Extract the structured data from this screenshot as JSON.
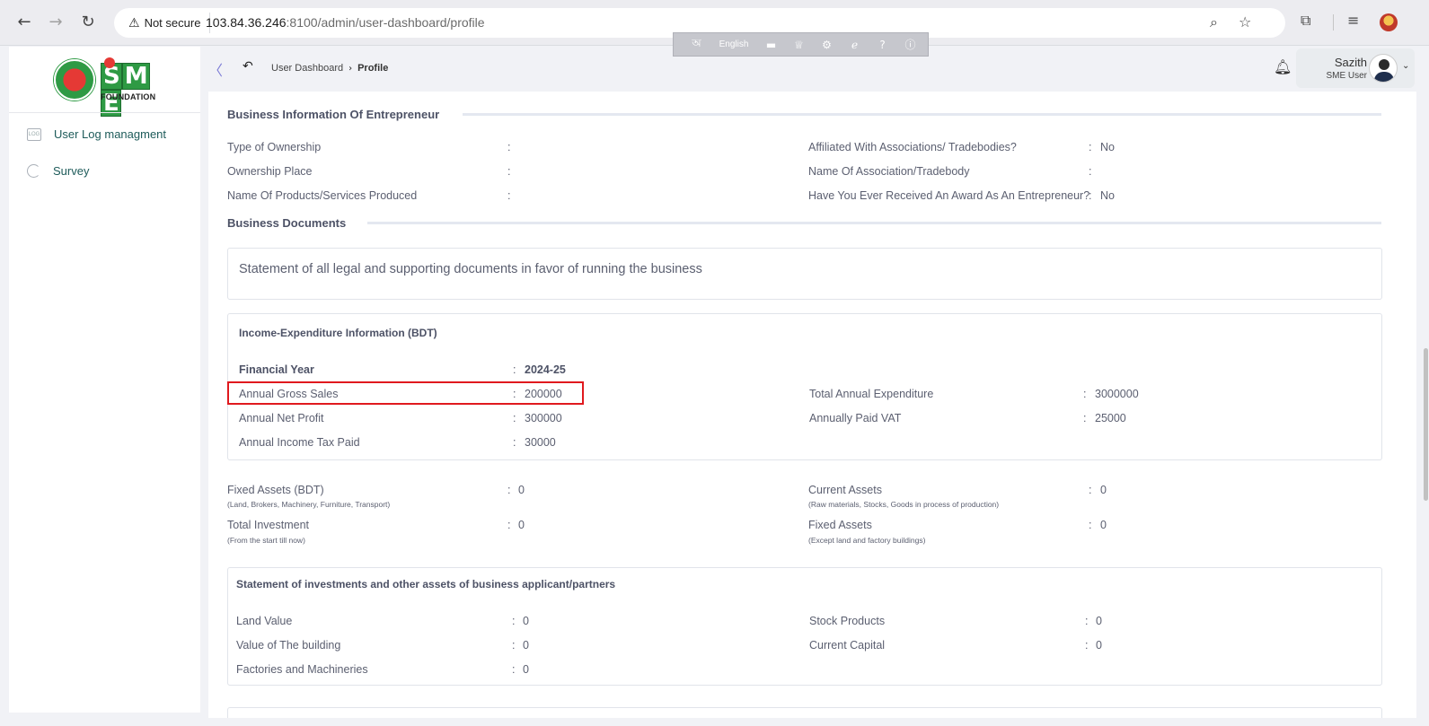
{
  "browser": {
    "security_label": "Not secure",
    "url_host": "103.84.36.246",
    "url_rest": ":8100/admin/user-dashboard/profile",
    "language_bar": {
      "language": "English"
    }
  },
  "sidebar": {
    "items": [
      {
        "label": "User Log managment",
        "icon": "log-icon"
      },
      {
        "label": "Survey",
        "icon": "pie-chart-icon"
      }
    ],
    "logo": {
      "text_s": "S",
      "text_m": "M",
      "text_e": "E",
      "foundation": "FOUNDATION"
    }
  },
  "header": {
    "breadcrumb": {
      "parent": "User Dashboard",
      "current": "Profile"
    },
    "user": {
      "name": "Sazith",
      "role": "SME User"
    }
  },
  "business_info": {
    "title": "Business Information Of Entrepreneur",
    "left": [
      {
        "label": "Type of Ownership",
        "value": ""
      },
      {
        "label": "Ownership Place",
        "value": ""
      },
      {
        "label": "Name Of Products/Services Produced",
        "value": ""
      }
    ],
    "right": [
      {
        "label": "Affiliated With Associations/ Tradebodies?",
        "value": "No"
      },
      {
        "label": "Name Of Association/Tradebody",
        "value": ""
      },
      {
        "label": "Have You Ever Received An Award As An Entrepreneur?",
        "value": "No"
      }
    ]
  },
  "business_documents": {
    "title": "Business Documents",
    "statement": "Statement of all legal and supporting documents in favor of running the business"
  },
  "income_expenditure": {
    "title": "Income-Expenditure Information (BDT)",
    "financial_year_label": "Financial Year",
    "financial_year_value": "2024-25",
    "left": [
      {
        "label": "Annual Gross Sales",
        "value": "200000"
      },
      {
        "label": "Annual Net Profit",
        "value": "300000"
      },
      {
        "label": "Annual Income Tax Paid",
        "value": "30000"
      }
    ],
    "right": [
      {
        "label": "Total Annual Expenditure",
        "value": "3000000"
      },
      {
        "label": "Annually Paid VAT",
        "value": "25000"
      }
    ]
  },
  "assets": {
    "left": [
      {
        "label": "Fixed Assets (BDT)",
        "sub": "(Land, Brokers, Machinery, Furniture, Transport)",
        "value": "0"
      },
      {
        "label": "Total Investment",
        "sub": "(From the start till now)",
        "value": "0"
      }
    ],
    "right": [
      {
        "label": "Current Assets",
        "sub": "(Raw materials, Stocks, Goods in process of production)",
        "value": "0"
      },
      {
        "label": "Fixed Assets",
        "sub": "(Except land and factory buildings)",
        "value": "0"
      }
    ]
  },
  "investments": {
    "title": "Statement of investments and other assets of business applicant/partners",
    "left": [
      {
        "label": "Land Value",
        "value": "0"
      },
      {
        "label": "Value of The building",
        "value": "0"
      },
      {
        "label": "Factories and Machineries",
        "value": "0"
      }
    ],
    "right": [
      {
        "label": "Stock Products",
        "value": "0"
      },
      {
        "label": "Current Capital",
        "value": "0"
      }
    ]
  },
  "colon": ":",
  "colors": {
    "highlight": "#e0191e",
    "sidebar_text": "#1e5b5a",
    "accent": "#7b7bd6"
  }
}
